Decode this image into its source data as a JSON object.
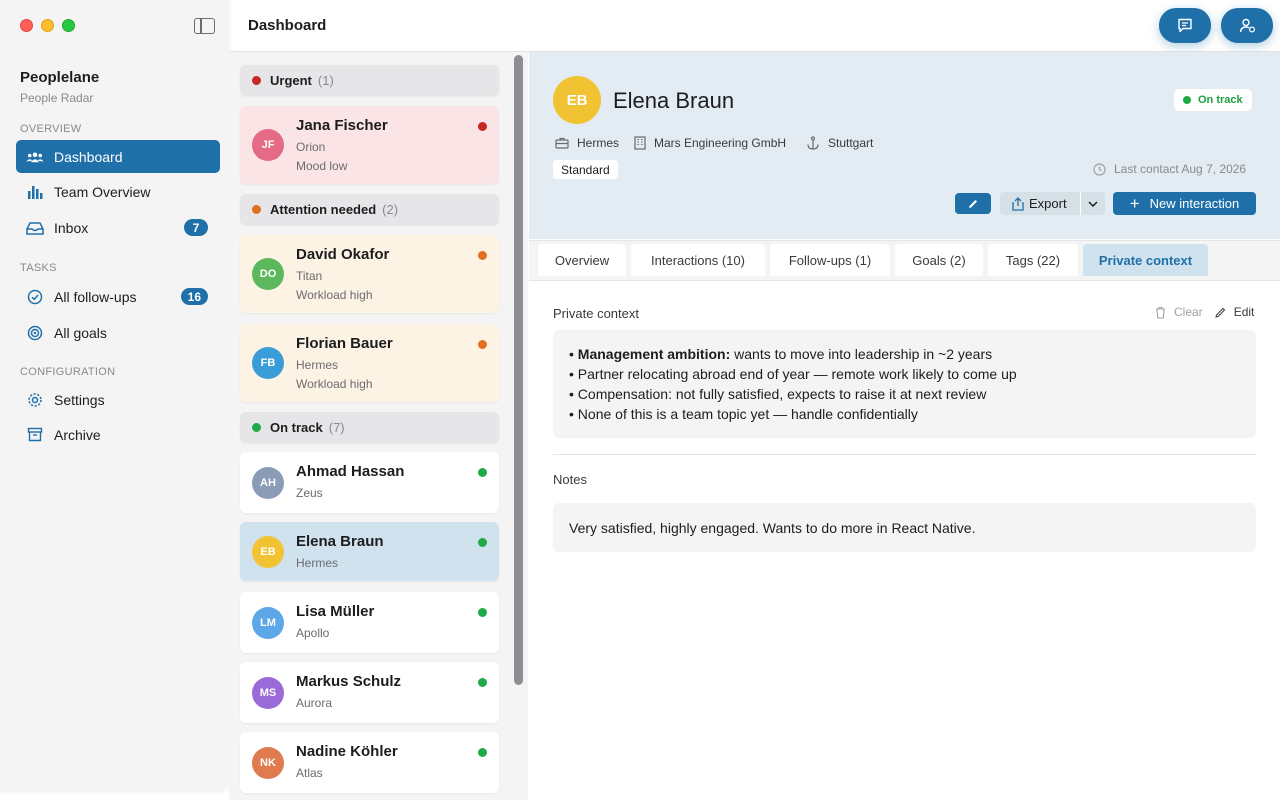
{
  "app": {
    "name": "Peoplelane",
    "subtitle": "People Radar"
  },
  "sidebar": {
    "sections": {
      "overview": "OVERVIEW",
      "tasks": "TASKS",
      "configuration": "CONFIGURATION"
    },
    "items": [
      {
        "label": "Dashboard",
        "icon": "people-icon",
        "active": true
      },
      {
        "label": "Team Overview",
        "icon": "bar-chart-icon"
      },
      {
        "label": "Inbox",
        "icon": "inbox-icon",
        "badge": "7"
      },
      {
        "label": "All follow-ups",
        "icon": "check-circle-icon",
        "badge": "16"
      },
      {
        "label": "All goals",
        "icon": "target-icon"
      },
      {
        "label": "Settings",
        "icon": "gear-icon"
      },
      {
        "label": "Archive",
        "icon": "archive-icon"
      }
    ]
  },
  "topbar": {
    "title": "Dashboard"
  },
  "colors": {
    "accent": "#1f6fa8",
    "urgent": "#c62828",
    "attention": "#e07020",
    "ontrack": "#1eaa44"
  },
  "groups": {
    "urgent": {
      "label": "Urgent",
      "count": "(1)"
    },
    "attention": {
      "label": "Attention needed",
      "count": "(2)"
    },
    "ontrack": {
      "label": "On track",
      "count": "(7)"
    }
  },
  "people": [
    {
      "initials": "JF",
      "name": "Jana Fischer",
      "team": "Orion",
      "mood": "Mood low",
      "color": "#e56a86"
    },
    {
      "initials": "DO",
      "name": "David Okafor",
      "team": "Titan",
      "mood": "Workload high",
      "color": "#5cb85c"
    },
    {
      "initials": "FB",
      "name": "Florian Bauer",
      "team": "Hermes",
      "mood": "Workload high",
      "color": "#3b9dd8"
    },
    {
      "initials": "AH",
      "name": "Ahmad Hassan",
      "team": "Zeus",
      "color": "#8a9cb8"
    },
    {
      "initials": "EB",
      "name": "Elena Braun",
      "team": "Hermes",
      "color": "#f1c231"
    },
    {
      "initials": "LM",
      "name": "Lisa Müller",
      "team": "Apollo",
      "color": "#5ba7e8"
    },
    {
      "initials": "MS",
      "name": "Markus Schulz",
      "team": "Aurora",
      "color": "#9a6bd8"
    },
    {
      "initials": "NK",
      "name": "Nadine Köhler",
      "team": "Atlas",
      "color": "#e07a4f"
    }
  ],
  "detail": {
    "initials": "EB",
    "name": "Elena Braun",
    "status": "On track",
    "team": "Hermes",
    "company": "Mars Engineering GmbH",
    "location": "Stuttgart",
    "tier": "Standard",
    "last_contact": "Last contact Aug 7, 2026",
    "export_label": "Export",
    "new_interaction_label": "New interaction",
    "tabs": [
      "Overview",
      "Interactions (10)",
      "Follow-ups (1)",
      "Goals (2)",
      "Tags (22)",
      "Private context"
    ],
    "private_context": {
      "title": "Private context",
      "clear_label": "Clear",
      "edit_label": "Edit",
      "lead_bold": "Management ambition:",
      "lead_rest": " wants to move into leadership in ~2 years",
      "line2": "Partner relocating abroad end of year — remote work likely to come up",
      "line3": "Compensation: not fully satisfied, expects to raise it at next review",
      "line4": "None of this is a team topic yet — handle confidentially"
    },
    "notes": {
      "title": "Notes",
      "text": "Very satisfied, highly engaged. Wants to do more in React Native."
    }
  }
}
